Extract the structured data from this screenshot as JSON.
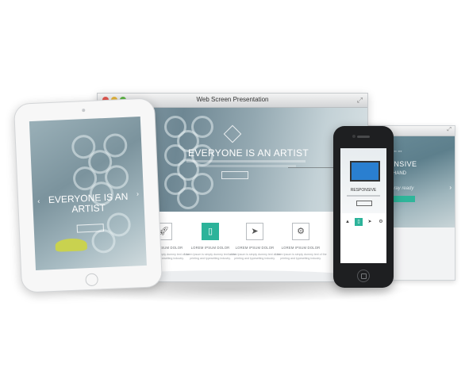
{
  "main_browser": {
    "title": "Web Screen Presentation",
    "hero_heading": "EVERYONE IS AN ARTIST",
    "feature_labels": [
      "LOREM IPSUM DOLOR",
      "LOREM IPSUM DOLOR",
      "LOREM IPSUM DOLOR",
      "LOREM IPSUM DOLOR"
    ],
    "feature_text": "Lorem Ipsum is simply dummy text of the printing and typesetting industry."
  },
  "tablet": {
    "hero_heading": "EVERYONE IS AN ARTIST"
  },
  "phone": {
    "heading": "RESPONSIVE"
  },
  "back_browser": {
    "heading": "ONSIVE",
    "subheading": "R HAND",
    "tagline": "Spray ready"
  },
  "colors": {
    "accent": "#2cb39a",
    "titlebar_red": "#e0574f",
    "titlebar_yellow": "#e2b33c",
    "titlebar_green": "#5db446"
  },
  "icons": [
    "rocket-icon",
    "mobile-icon",
    "paper-plane-icon",
    "gear-icon"
  ]
}
